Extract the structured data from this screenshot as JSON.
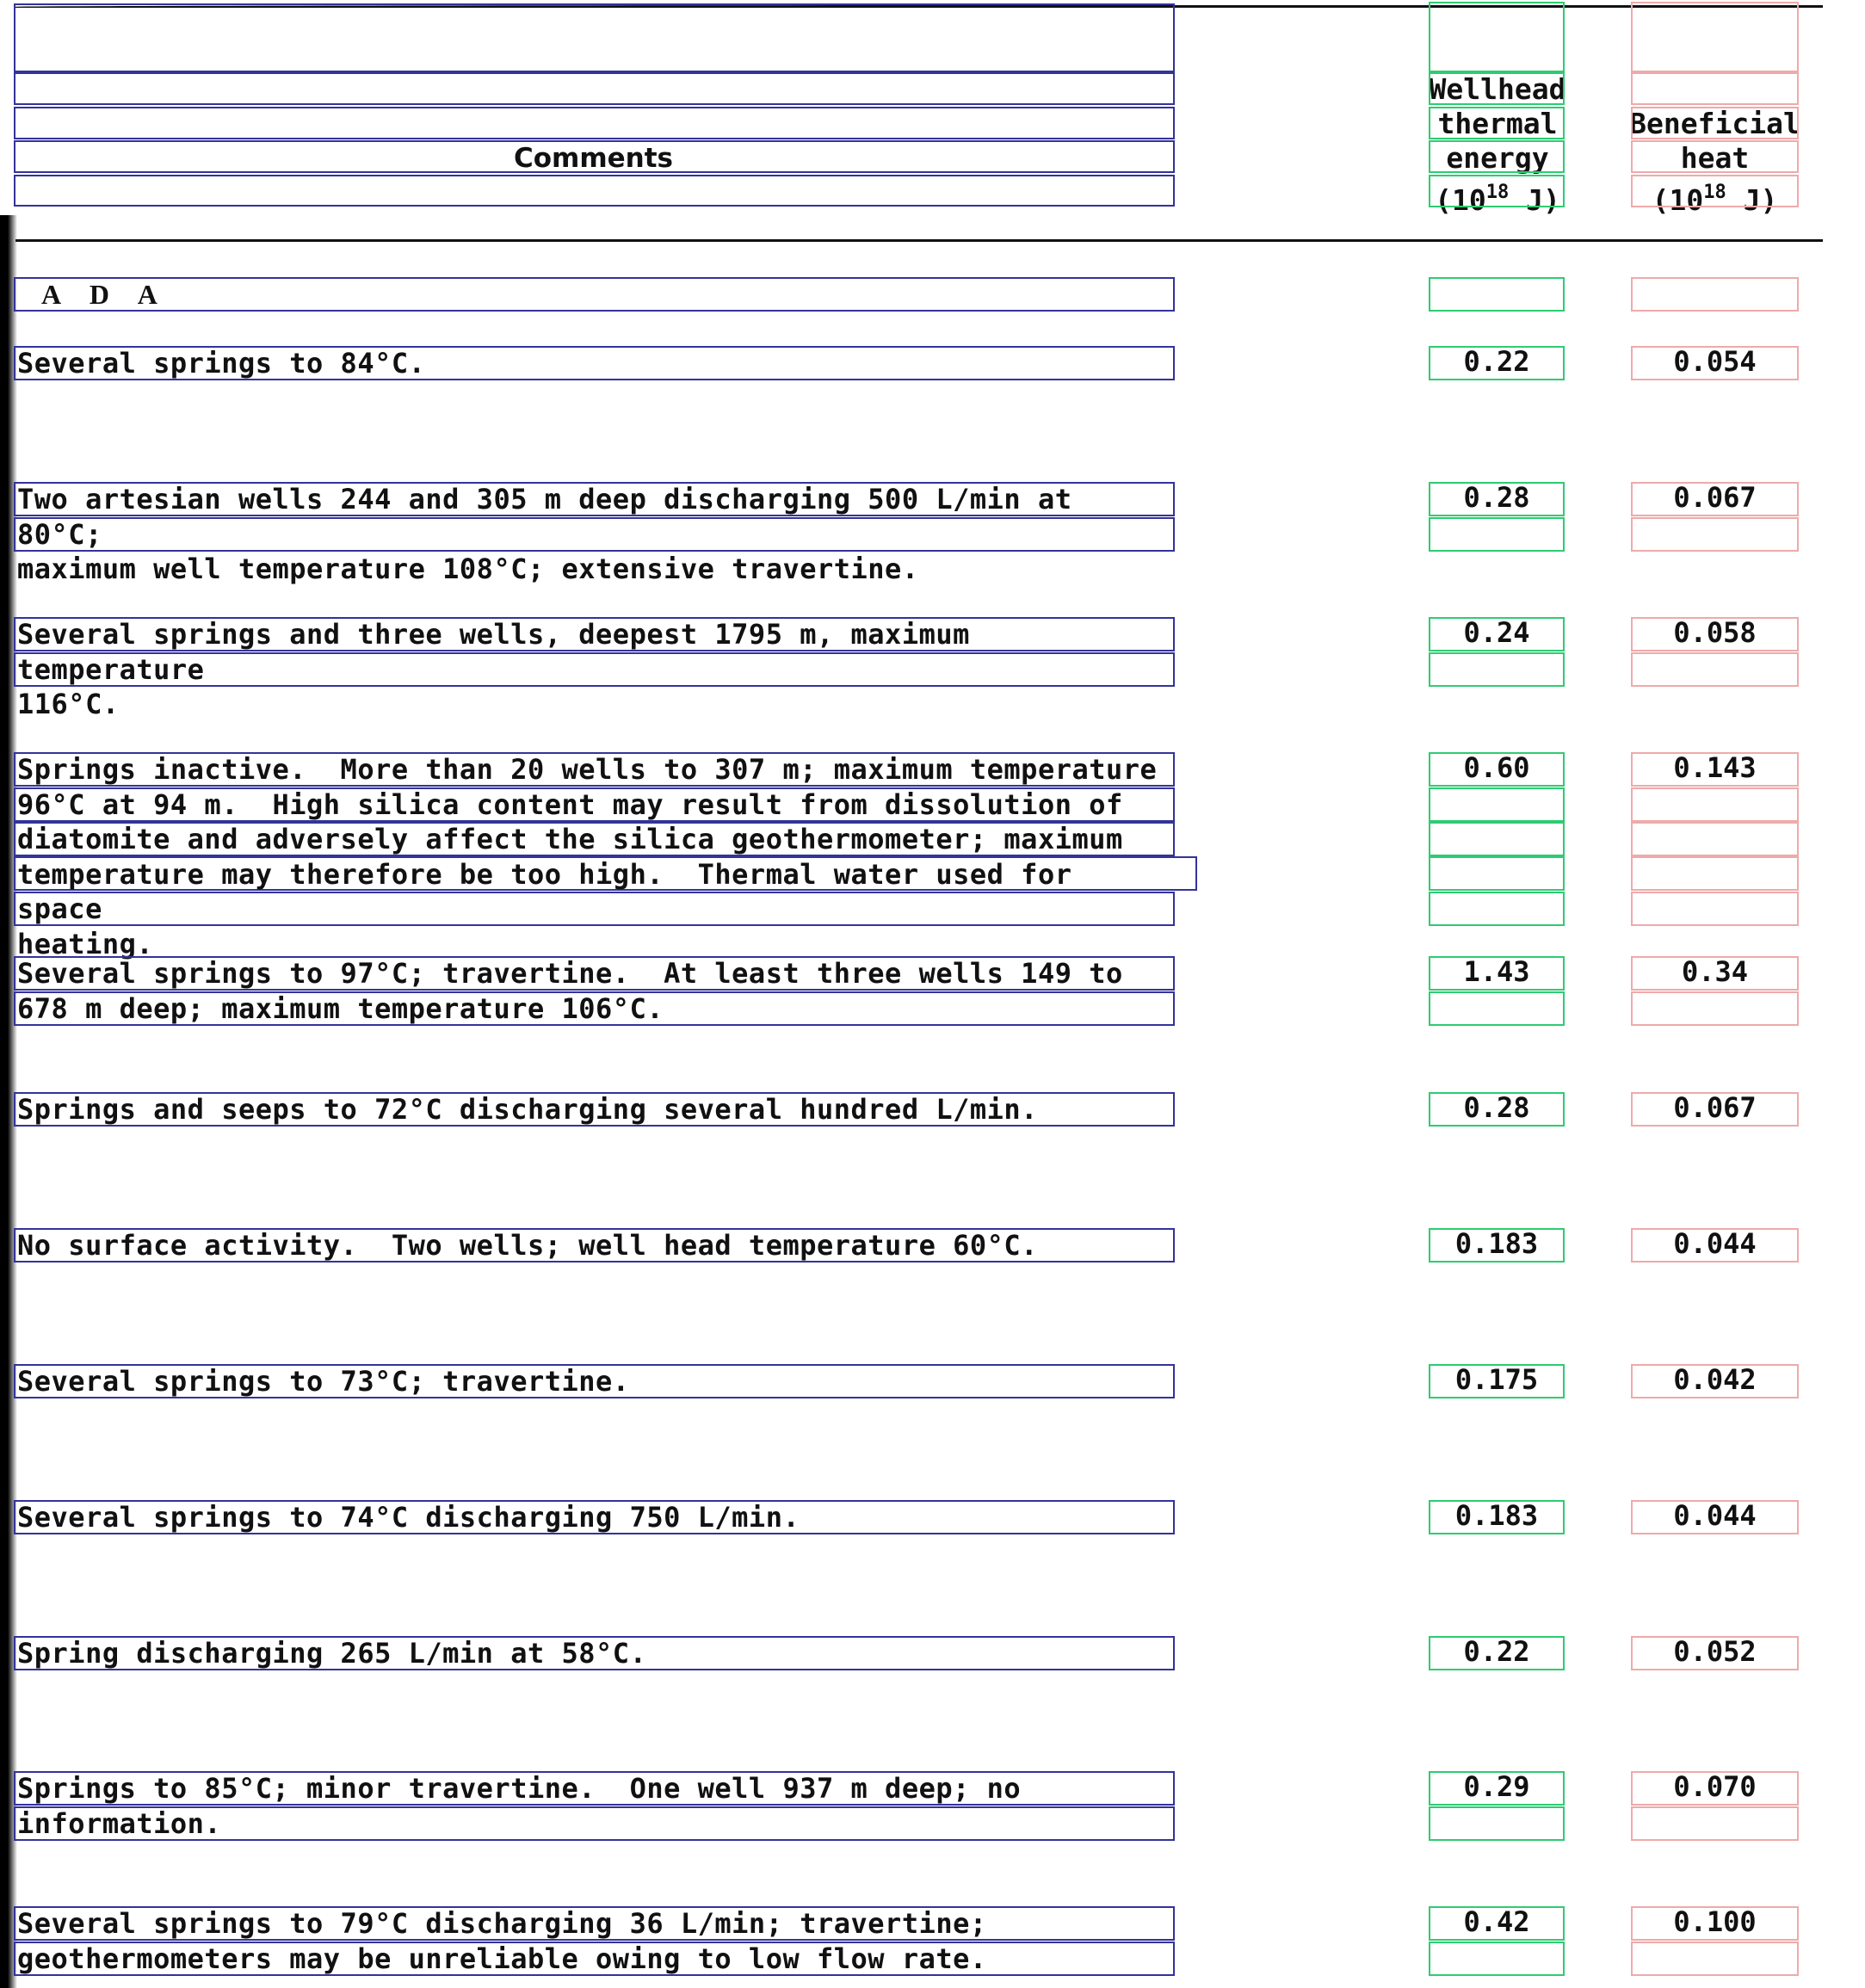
{
  "header": {
    "comments_label": "Comments",
    "col_energy_lines": [
      "Wellhead",
      "thermal",
      "energy"
    ],
    "col_energy_unit_prefix": "(10",
    "col_energy_unit_sup": "18",
    "col_energy_unit_suffix": " J)",
    "col_heat_lines": [
      "Beneficial",
      "heat"
    ],
    "col_heat_unit_prefix": "(10",
    "col_heat_unit_sup": "18",
    "col_heat_unit_suffix": " J)"
  },
  "rows": [
    {
      "comment": "A    D    A",
      "energy": "",
      "heat": ""
    },
    {
      "comment": "Several springs to 84°C.",
      "energy": "0.22",
      "heat": "0.054"
    },
    {
      "comment": "Two artesian wells 244 and 305 m deep discharging 500 L/min at 80°C;\nmaximum well temperature 108°C; extensive travertine.",
      "energy": "0.28",
      "heat": "0.067"
    },
    {
      "comment": "Several springs and three wells, deepest 1795 m, maximum temperature\n116°C.",
      "energy": "0.24",
      "heat": "0.058"
    },
    {
      "comment": "Springs inactive.  More than 20 wells to 307 m; maximum temperature\n96°C at 94 m.  High silica content may result from dissolution of\ndiatomite and adversely affect the silica geothermometer; maximum\ntemperature may therefore be too high.  Thermal water used for space\nheating.",
      "energy": "0.60",
      "heat": "0.143"
    },
    {
      "comment": "Several springs to 97°C; travertine.  At least three wells 149 to\n678 m deep; maximum temperature 106°C.",
      "energy": "1.43",
      "heat": "0.34"
    },
    {
      "comment": "Springs and seeps to 72°C discharging several hundred L/min.",
      "energy": "0.28",
      "heat": "0.067"
    },
    {
      "comment": "No surface activity.  Two wells; well head temperature 60°C.",
      "energy": "0.183",
      "heat": "0.044"
    },
    {
      "comment": "Several springs to 73°C; travertine.",
      "energy": "0.175",
      "heat": "0.042"
    },
    {
      "comment": "Several springs to 74°C discharging 750 L/min.",
      "energy": "0.183",
      "heat": "0.044"
    },
    {
      "comment": "Spring discharging 265 L/min at 58°C.",
      "energy": "0.22",
      "heat": "0.052"
    },
    {
      "comment": "Springs to 85°C; minor travertine.  One well 937 m deep; no\ninformation.",
      "energy": "0.29",
      "heat": "0.070"
    },
    {
      "comment": "Several springs to 79°C discharging 36 L/min; travertine;\ngeothermometers may be unreliable owing to low flow rate.",
      "energy": "0.42",
      "heat": "0.100"
    }
  ]
}
